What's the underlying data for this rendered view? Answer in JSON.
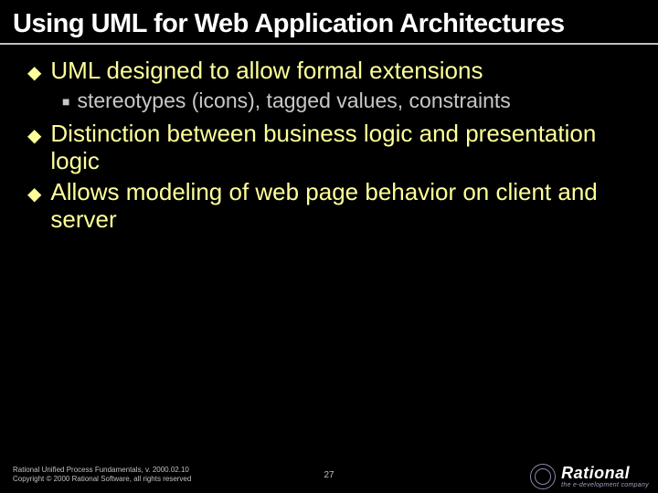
{
  "title": "Using UML for Web Application Architectures",
  "bullets": [
    {
      "text": "UML designed to allow formal extensions",
      "sub": [
        "stereotypes (icons), tagged values, constraints"
      ]
    },
    {
      "text": "Distinction between business logic and presentation logic",
      "sub": []
    },
    {
      "text": "Allows modeling of web page behavior on client and server",
      "sub": []
    }
  ],
  "footer": {
    "line1": "Rational Unified Process Fundamentals, v. 2000.02.10",
    "line2": "Copyright © 2000 Rational Software, all rights reserved",
    "page": "27",
    "logo_name": "Rational",
    "logo_tag": "the e-development company"
  }
}
